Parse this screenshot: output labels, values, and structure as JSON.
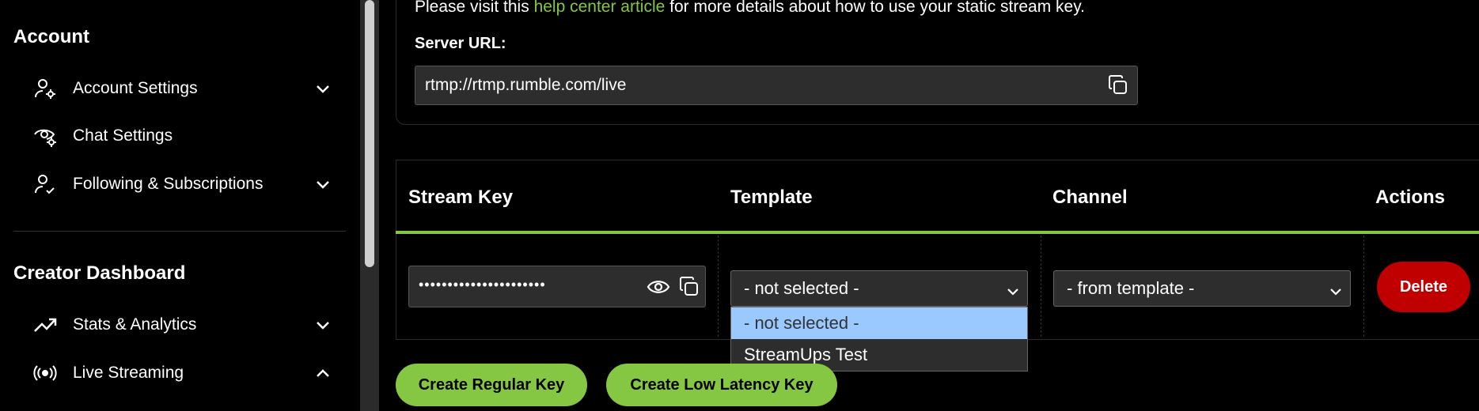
{
  "sidebar": {
    "account_title": "Account",
    "creator_title": "Creator Dashboard",
    "items": [
      {
        "label": "Account Settings",
        "icon": "user-gear-icon",
        "chevron": "down"
      },
      {
        "label": "Chat Settings",
        "icon": "eye-gear-icon",
        "chevron": ""
      },
      {
        "label": "Following & Subscriptions",
        "icon": "user-check-icon",
        "chevron": "down"
      },
      {
        "label": "Stats & Analytics",
        "icon": "trending-up-icon",
        "chevron": "down"
      },
      {
        "label": "Live Streaming",
        "icon": "broadcast-icon",
        "chevron": "up"
      }
    ]
  },
  "info": {
    "prefix": "Please visit this ",
    "link": "help center article",
    "suffix": " for more details about how to use your static stream key."
  },
  "server": {
    "label": "Server URL:",
    "value": "rtmp://rtmp.rumble.com/live"
  },
  "table": {
    "headers": [
      "Stream Key",
      "Template",
      "Channel",
      "Actions"
    ],
    "stream_key_masked": "••••••••••••••••••••••",
    "template_selected": "- not selected -",
    "template_options": [
      "- not selected -",
      "StreamUps Test"
    ],
    "channel_selected": "- from template -",
    "delete_label": "Delete"
  },
  "buttons": {
    "create_regular": "Create Regular Key",
    "create_low_latency": "Create Low Latency Key"
  },
  "colors": {
    "accent_green": "#85c742",
    "delete_red": "#c00000",
    "dropdown_highlight": "#99c9ff"
  }
}
